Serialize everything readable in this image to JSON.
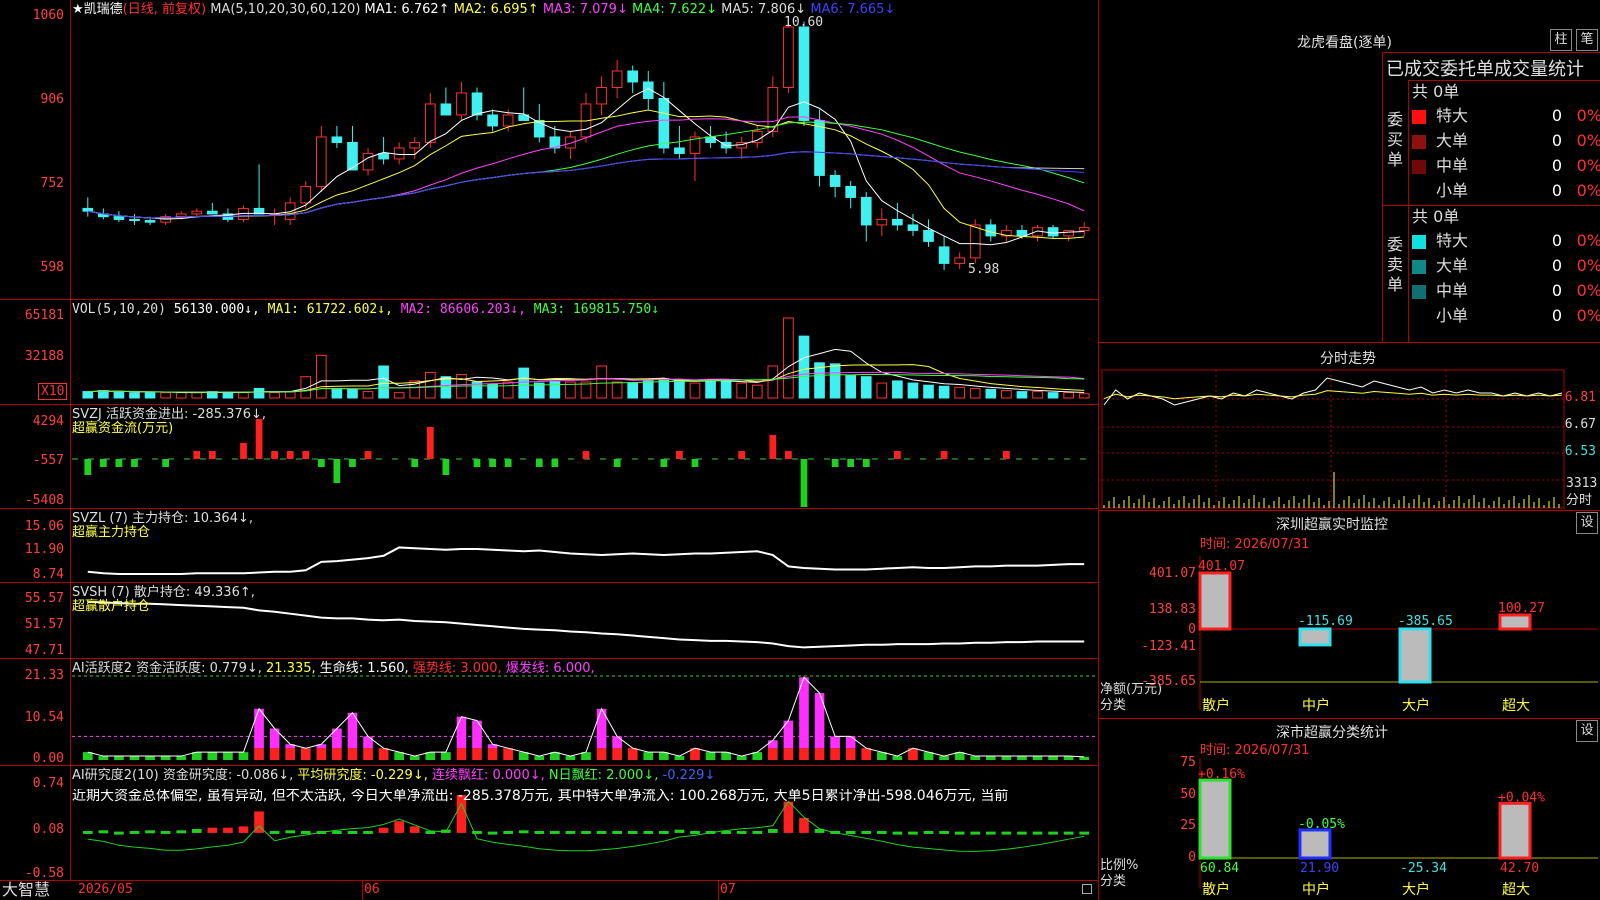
{
  "header": {
    "stock_name": "★凯瑞德",
    "period": "(日线, 前复权)",
    "ma_param": "MA(5,10,20,30,60,120)",
    "ma1": "MA1: 6.762↑",
    "ma2": "MA2: 6.695↑",
    "ma3": "MA3: 7.079↓",
    "ma4": "MA4: 7.622↓",
    "ma5": "MA5: 7.806↓",
    "ma6": "MA6: 7.665↓"
  },
  "price_axis": [
    "1060",
    "906",
    "752",
    "598"
  ],
  "price_marks": {
    "high": "10.60",
    "low": "5.98",
    "high_val": 10.6,
    "low_val": 5.98
  },
  "vol_panel": {
    "title": "VOL(5,10,20)",
    "vol": "56130.000↓,",
    "ma1": "MA1: 61722.602↓,",
    "ma2": "MA2: 86606.203↓,",
    "ma3": "MA3: 169815.750↓",
    "axis": [
      "65181",
      "32188"
    ],
    "unit": "X10"
  },
  "svzj_panel": {
    "title": "SVZJ  活跃资金进出: -285.376↓,",
    "subtitle": "超赢资金流(万元)",
    "axis": [
      "4294",
      "-557",
      "-5408"
    ]
  },
  "svzl_panel": {
    "title": "SVZL (7) 主力持仓: 10.364↓,",
    "subtitle": "超赢主力持仓",
    "axis": [
      "15.06",
      "11.90",
      "8.74"
    ]
  },
  "svsh_panel": {
    "title": "SVSH (7) 散户持仓: 49.336↑,",
    "subtitle": "超赢散户持仓",
    "axis": [
      "55.57",
      "51.57",
      "47.71"
    ]
  },
  "ai_active_panel": {
    "title": "AI活跃度2 资金活跃度: 0.779↓,",
    "v2": "21.335,",
    "life": "生命线: 1.560,",
    "strong": "强势线: 3.000,",
    "burst": "爆发线: 6.000,",
    "axis": [
      "21.33",
      "10.54",
      "0.00"
    ]
  },
  "ai_research_panel": {
    "title": "AI研究度2(10) 资金研究度: -0.086↓,",
    "avg": "平均研究度: -0.229↓,",
    "red": "连续飘红: 0.000↓,",
    "nred": "N日飘红: 2.000↓,",
    "last": "-0.229↓",
    "comment": "近期大资金总体偏空, 虽有异动, 但不太活跃, 今日大单净流出: -285.378万元, 其中特大单净流入: 100.268万元, 大单5日累计净出-598.046万元, 当前",
    "axis": [
      "0.74",
      "0.08",
      "-0.58"
    ]
  },
  "date_axis": {
    "brand": "大智慧",
    "labels": [
      "2026/05",
      "06",
      "07"
    ]
  },
  "right": {
    "dragon_title": "龙虎看盘(逐单)",
    "btn1": "柱",
    "btn2": "笔",
    "stat_title": "已成交委托单成交量统计",
    "buy": {
      "total": "共 0单",
      "label": "委买单",
      "rows": [
        {
          "name": "特大",
          "v": "0",
          "p": "0%",
          "color": "#ff1010"
        },
        {
          "name": "大单",
          "v": "0",
          "p": "0%",
          "color": "#901010"
        },
        {
          "name": "中单",
          "v": "0",
          "p": "0%",
          "color": "#700808"
        },
        {
          "name": "小单",
          "v": "0",
          "p": "0%",
          "color": "#000000"
        }
      ]
    },
    "sell": {
      "total": "共 0单",
      "label": "委卖单",
      "rows": [
        {
          "name": "特大",
          "v": "0",
          "p": "0%",
          "color": "#10e0e0"
        },
        {
          "name": "大单",
          "v": "0",
          "p": "0%",
          "color": "#108888"
        },
        {
          "name": "中单",
          "v": "0",
          "p": "0%",
          "color": "#107070"
        },
        {
          "name": "小单",
          "v": "0",
          "p": "0%",
          "color": "#000000"
        }
      ]
    },
    "fenshi": {
      "title": "分时走势",
      "axis": [
        "6.81",
        "6.67",
        "6.53"
      ],
      "vol": "3313",
      "unit": "分时"
    },
    "sz_monitor": {
      "title": "深圳超赢实时监控",
      "btn": "设",
      "time": "时间: 2026/07/31",
      "axis": [
        "401.07",
        "138.83",
        "0",
        "-123.41",
        "-385.65"
      ],
      "ylabel": "净额(万元)",
      "xlabel": "分类",
      "categories": [
        "散户",
        "中户",
        "大户",
        "超大"
      ],
      "values": [
        401.07,
        -115.69,
        -385.65,
        100.27
      ],
      "value_labels": [
        "401.07",
        "-115.69",
        "-385.65",
        "100.27"
      ]
    },
    "sz_class": {
      "title": "深市超赢分类统计",
      "btn": "设",
      "time": "时间: 2026/07/31",
      "axis": [
        "75",
        "50",
        "25",
        "0"
      ],
      "ylabel": "比例%",
      "xlabel": "分类",
      "categories": [
        "散户",
        "中户",
        "大户",
        "超大"
      ],
      "top_labels": [
        "+0.16%",
        "-0.05%",
        "",
        "+0.04%"
      ],
      "bottom_labels": [
        "60.84",
        "21.90",
        "-25.34",
        "42.70"
      ],
      "values": [
        60.84,
        21.9,
        -25.34,
        42.7
      ]
    }
  },
  "chart_data": {
    "type": "candlestick",
    "candles": [
      [
        7.1,
        7.3,
        6.95,
        7.05
      ],
      [
        7.0,
        7.1,
        6.9,
        6.95
      ],
      [
        6.95,
        7.05,
        6.85,
        6.9
      ],
      [
        6.9,
        7.0,
        6.8,
        6.88
      ],
      [
        6.88,
        6.95,
        6.8,
        6.85
      ],
      [
        6.85,
        7.0,
        6.8,
        6.95
      ],
      [
        6.95,
        7.05,
        6.9,
        7.0
      ],
      [
        7.0,
        7.1,
        6.95,
        7.05
      ],
      [
        7.05,
        7.2,
        7.0,
        7.0
      ],
      [
        7.0,
        7.1,
        6.85,
        6.9
      ],
      [
        6.9,
        7.15,
        6.85,
        7.1
      ],
      [
        7.1,
        7.9,
        7.0,
        7.0
      ],
      [
        7.0,
        7.1,
        6.8,
        7.0
      ],
      [
        6.9,
        7.3,
        6.8,
        7.2
      ],
      [
        7.2,
        7.6,
        7.1,
        7.5
      ],
      [
        7.5,
        8.6,
        7.4,
        8.4
      ],
      [
        8.4,
        8.6,
        8.2,
        8.3
      ],
      [
        8.3,
        8.6,
        7.8,
        7.8
      ],
      [
        7.8,
        8.2,
        7.7,
        8.1
      ],
      [
        8.1,
        8.4,
        7.9,
        8.0
      ],
      [
        8.0,
        8.3,
        7.9,
        8.2
      ],
      [
        8.2,
        8.4,
        8.0,
        8.3
      ],
      [
        8.3,
        9.2,
        8.2,
        9.0
      ],
      [
        9.0,
        9.3,
        8.8,
        8.8
      ],
      [
        8.8,
        9.4,
        8.7,
        9.2
      ],
      [
        9.2,
        9.3,
        8.7,
        8.8
      ],
      [
        8.8,
        8.9,
        8.5,
        8.6
      ],
      [
        8.6,
        8.9,
        8.5,
        8.8
      ],
      [
        8.8,
        9.3,
        8.7,
        8.7
      ],
      [
        8.7,
        9.0,
        8.3,
        8.4
      ],
      [
        8.4,
        8.6,
        8.1,
        8.2
      ],
      [
        8.2,
        8.5,
        8.0,
        8.4
      ],
      [
        8.4,
        9.2,
        8.3,
        9.0
      ],
      [
        9.0,
        9.5,
        8.8,
        9.3
      ],
      [
        9.3,
        9.8,
        9.1,
        9.6
      ],
      [
        9.6,
        9.7,
        9.2,
        9.4
      ],
      [
        9.4,
        9.6,
        8.9,
        9.1
      ],
      [
        9.1,
        9.4,
        8.1,
        8.2
      ],
      [
        8.2,
        8.6,
        8.0,
        8.1
      ],
      [
        8.1,
        8.5,
        7.6,
        8.4
      ],
      [
        8.4,
        8.6,
        8.2,
        8.3
      ],
      [
        8.3,
        8.5,
        8.1,
        8.2
      ],
      [
        8.2,
        8.4,
        8.0,
        8.3
      ],
      [
        8.3,
        8.6,
        8.2,
        8.5
      ],
      [
        8.5,
        9.5,
        8.4,
        9.3
      ],
      [
        9.3,
        10.6,
        9.2,
        10.4
      ],
      [
        10.4,
        10.5,
        8.6,
        8.7
      ],
      [
        8.7,
        8.9,
        7.5,
        7.7
      ],
      [
        7.7,
        7.8,
        7.3,
        7.5
      ],
      [
        7.5,
        7.6,
        7.1,
        7.3
      ],
      [
        7.3,
        7.4,
        6.5,
        6.8
      ],
      [
        6.8,
        7.1,
        6.6,
        6.9
      ],
      [
        6.9,
        7.2,
        6.7,
        6.8
      ],
      [
        6.8,
        7.0,
        6.6,
        6.7
      ],
      [
        6.7,
        6.9,
        6.4,
        6.5
      ],
      [
        6.4,
        6.6,
        5.98,
        6.1
      ],
      [
        6.1,
        6.3,
        6.0,
        6.2
      ],
      [
        6.2,
        6.9,
        6.1,
        6.8
      ],
      [
        6.8,
        6.9,
        6.5,
        6.6
      ],
      [
        6.6,
        6.8,
        6.5,
        6.7
      ],
      [
        6.7,
        6.8,
        6.55,
        6.6
      ],
      [
        6.6,
        6.8,
        6.5,
        6.75
      ],
      [
        6.75,
        6.8,
        6.55,
        6.6
      ],
      [
        6.6,
        6.7,
        6.5,
        6.7
      ],
      [
        6.7,
        6.85,
        6.6,
        6.75
      ]
    ],
    "volume": [
      6,
      7,
      6,
      5,
      5,
      5,
      5,
      5,
      6,
      5,
      5,
      9,
      5,
      6,
      20,
      40,
      9,
      8,
      6,
      30,
      5,
      16,
      24,
      20,
      22,
      15,
      13,
      15,
      28,
      14,
      16,
      15,
      15,
      30,
      15,
      14,
      16,
      18,
      16,
      14,
      17,
      16,
      14,
      12,
      30,
      75,
      58,
      33,
      32,
      21,
      20,
      14,
      16,
      14,
      12,
      11,
      10,
      9,
      8,
      7,
      6,
      6,
      5,
      5,
      4
    ],
    "svzj": [
      -2,
      -1,
      -1,
      -1,
      0,
      -1,
      0,
      1,
      1,
      0,
      2,
      5,
      1,
      1,
      1,
      -1,
      -3,
      -1,
      1,
      0,
      0,
      -1,
      4,
      -2,
      0,
      -1,
      -1,
      -1,
      0,
      -1,
      -1,
      0,
      1,
      0,
      -1,
      0,
      0,
      -1,
      1,
      -1,
      0,
      0,
      1,
      0,
      3,
      1,
      -6,
      0,
      -1,
      -1,
      -1,
      0,
      1,
      0,
      0,
      1,
      0,
      0,
      0,
      1,
      0,
      0,
      0,
      0,
      0
    ],
    "svzl": [
      9.3,
      9.1,
      9.0,
      9.0,
      9.0,
      9.0,
      9.0,
      9.1,
      9.1,
      9.1,
      9.1,
      9.2,
      9.3,
      9.3,
      9.5,
      10.6,
      10.7,
      10.9,
      11.1,
      11.4,
      12.5,
      12.4,
      12.3,
      12.2,
      12.3,
      12.3,
      12.2,
      12.1,
      12.0,
      12.1,
      11.9,
      11.7,
      11.6,
      11.5,
      11.6,
      11.7,
      11.6,
      11.5,
      11.6,
      11.7,
      11.7,
      11.8,
      11.9,
      12.0,
      11.5,
      10.0,
      9.8,
      9.7,
      9.6,
      9.6,
      9.6,
      9.7,
      9.8,
      9.9,
      9.8,
      9.8,
      9.9,
      10.0,
      10.0,
      10.1,
      10.1,
      10.1,
      10.2,
      10.3,
      10.3
    ],
    "svsh": [
      55.3,
      55.2,
      55.1,
      55.0,
      55.0,
      54.9,
      54.8,
      54.7,
      54.6,
      54.5,
      54.4,
      54.0,
      53.8,
      53.5,
      53.2,
      52.9,
      52.8,
      52.8,
      52.6,
      52.5,
      52.6,
      52.4,
      52.3,
      52.2,
      52.0,
      51.8,
      51.6,
      51.4,
      51.2,
      51.1,
      51.0,
      50.8,
      50.7,
      50.5,
      50.4,
      50.2,
      50.0,
      49.8,
      49.6,
      49.5,
      49.4,
      49.4,
      49.3,
      49.2,
      49.0,
      48.6,
      48.4,
      48.5,
      48.6,
      48.7,
      48.8,
      48.8,
      48.9,
      48.9,
      48.9,
      49.0,
      49.0,
      49.1,
      49.1,
      49.2,
      49.2,
      49.3,
      49.3,
      49.3,
      49.3
    ],
    "ai_active": [
      2,
      1,
      1,
      1,
      1,
      1,
      1,
      2,
      2,
      2,
      2,
      13,
      8,
      4,
      3,
      4,
      8,
      12,
      6,
      3,
      2,
      1,
      2,
      2,
      11,
      10,
      4,
      3,
      2,
      1,
      2,
      1,
      2,
      13,
      6,
      3,
      2,
      2,
      1,
      3,
      2,
      2,
      1,
      2,
      5,
      10,
      21,
      17,
      6,
      6,
      3,
      2,
      1,
      3,
      2,
      1,
      2,
      1,
      1,
      1,
      1,
      1,
      1,
      1,
      0.8
    ],
    "ai_research": [
      0.05,
      0.06,
      0.04,
      0.05,
      0.06,
      0.05,
      0.06,
      0.08,
      0.1,
      0.1,
      0.12,
      0.35,
      0.05,
      0.06,
      0.05,
      0.05,
      0.05,
      0.05,
      0.05,
      0.1,
      0.2,
      0.12,
      0.05,
      0.07,
      0.6,
      0.05,
      0.04,
      0.05,
      0.06,
      0.05,
      0.05,
      0.05,
      0.05,
      0.05,
      0.05,
      0.05,
      0.05,
      0.05,
      0.07,
      0.05,
      0.05,
      0.05,
      0.05,
      0.05,
      0.08,
      0.5,
      0.25,
      0.08,
      0.05,
      0.05,
      0.05,
      0.05,
      0.04,
      0.04,
      0.05,
      0.05,
      0.04,
      0.04,
      0.04,
      0.04,
      0.04,
      0.04,
      0.04,
      0.04,
      0.04
    ],
    "fenshi": [
      6.7,
      6.75,
      6.72,
      6.74,
      6.73,
      6.72,
      6.7,
      6.71,
      6.72,
      6.73,
      6.72,
      6.74,
      6.73,
      6.75,
      6.74,
      6.73,
      6.72,
      6.74,
      6.75,
      6.79,
      6.78,
      6.77,
      6.76,
      6.78,
      6.77,
      6.76,
      6.75,
      6.76,
      6.74,
      6.75,
      6.74,
      6.75,
      6.74,
      6.74,
      6.73,
      6.74,
      6.73,
      6.74,
      6.73,
      6.74
    ]
  }
}
